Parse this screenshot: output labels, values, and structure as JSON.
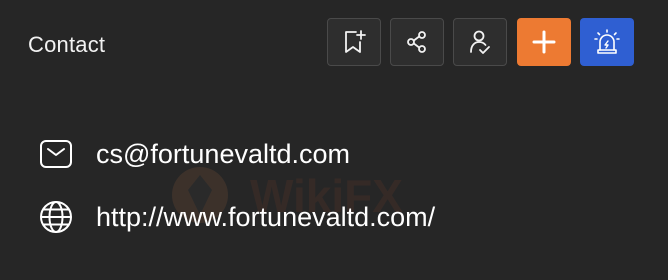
{
  "section": {
    "title": "Contact"
  },
  "toolbar": {
    "buttons": [
      {
        "icon": "bookmark-add-icon"
      },
      {
        "icon": "share-icon"
      },
      {
        "icon": "user-check-icon"
      },
      {
        "icon": "plus-icon",
        "color": "#ed7a32"
      },
      {
        "icon": "alarm-light-icon",
        "color": "#2f5fd2"
      }
    ]
  },
  "contact": {
    "email": "cs@fortunevaltd.com",
    "website": "http://www.fortunevaltd.com/"
  },
  "colors": {
    "background": "#262626",
    "accent_orange": "#ed7a32",
    "accent_blue": "#2f5fd2"
  }
}
